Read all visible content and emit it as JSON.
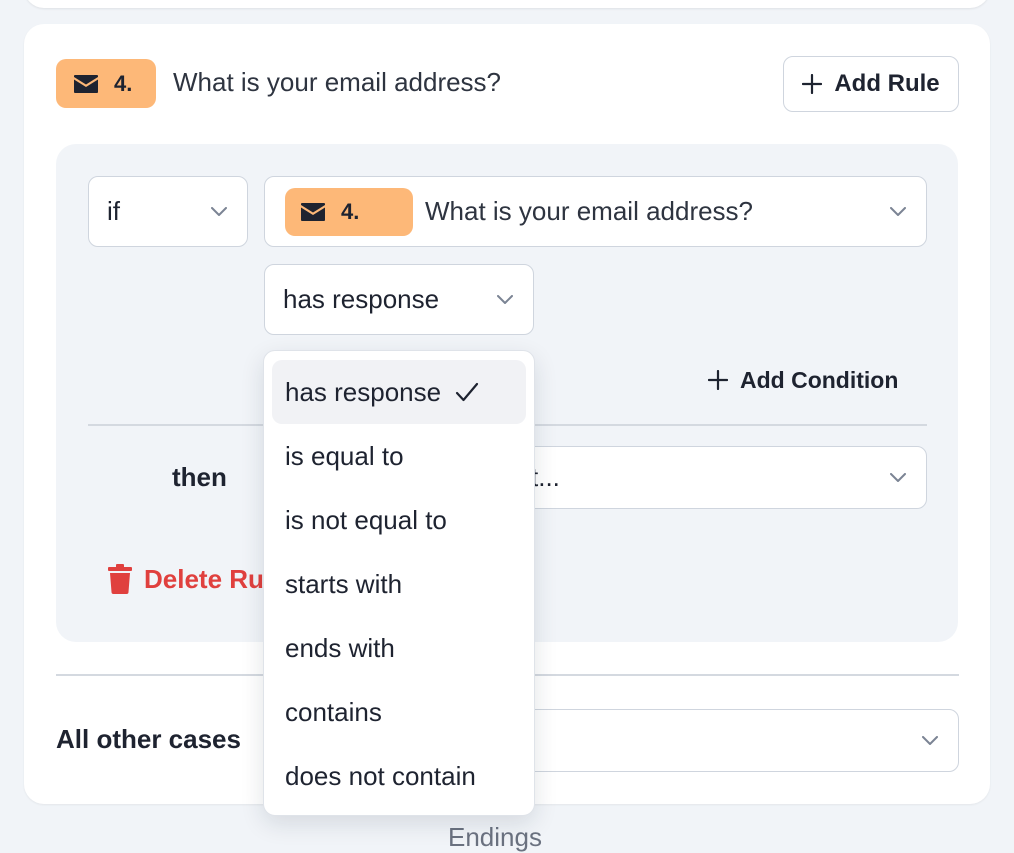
{
  "question": {
    "number": "4.",
    "icon": "mail-icon",
    "title": "What is your email address?",
    "add_rule_label": "Add Rule"
  },
  "rule": {
    "if_label": "if",
    "question_number": "4.",
    "question_title": "What is your email address?",
    "operator_value": "has response",
    "add_condition_label": "Add Condition",
    "then_label": "then",
    "then_value": "t...",
    "delete_label": "Delete Rule"
  },
  "other_cases": {
    "label": "All other cases"
  },
  "operator_menu": {
    "items": [
      {
        "label": "has response",
        "selected": true
      },
      {
        "label": "is equal to",
        "selected": false
      },
      {
        "label": "is not equal to",
        "selected": false
      },
      {
        "label": "starts with",
        "selected": false
      },
      {
        "label": "ends with",
        "selected": false
      },
      {
        "label": "contains",
        "selected": false
      },
      {
        "label": "does not contain",
        "selected": false
      }
    ]
  },
  "footer": {
    "section_label": "Endings"
  },
  "colors": {
    "badge": "#fdb878",
    "danger": "#e0403e",
    "page_bg": "#f1f4f8",
    "border": "#cfd5de"
  }
}
